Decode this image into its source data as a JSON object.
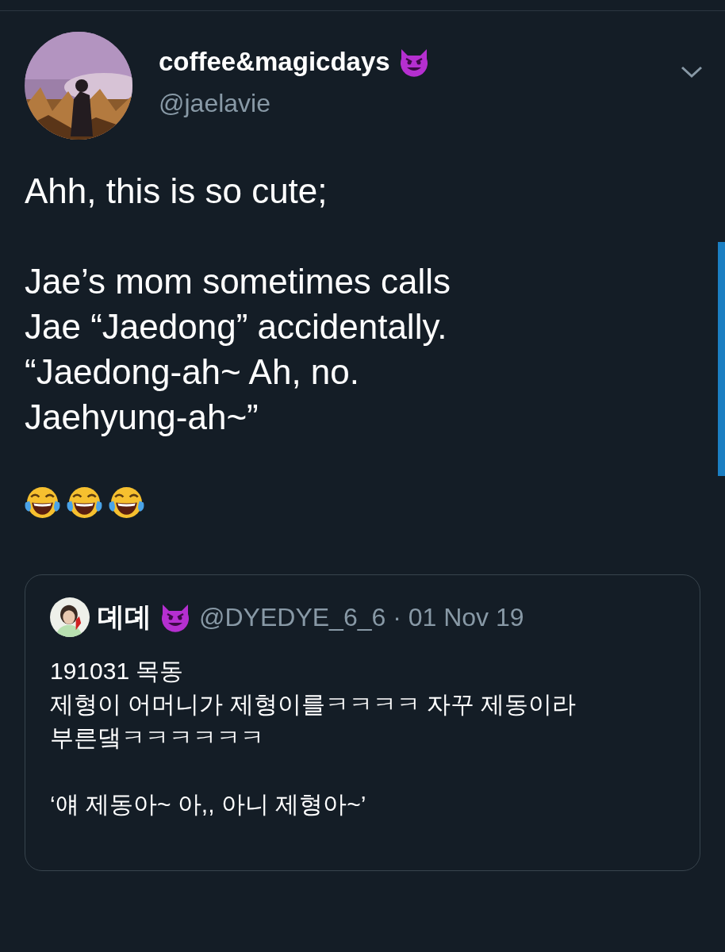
{
  "author": {
    "name": "coffee&magicdays",
    "handle": "@jaelavie"
  },
  "tweet": {
    "paragraphs": [
      "Ahh, this is so cute;",
      "Jae’s mom sometimes calls\nJae “Jaedong” accidentally.\n“Jaedong-ah~ Ah, no.\nJaehyung-ah~”"
    ]
  },
  "quote": {
    "name": "뎨뎨",
    "meta": "@DYEDYE_6_6 · 01 Nov 19",
    "paragraphs": [
      "191031 목동\n제형이 어머니가 제형이를ㅋㅋㅋㅋ 자꾸 제동이라\n부른댘ㅋㅋㅋㅋㅋㅋ",
      "‘얘 제동아~ 아,, 아니 제형아~’"
    ]
  }
}
